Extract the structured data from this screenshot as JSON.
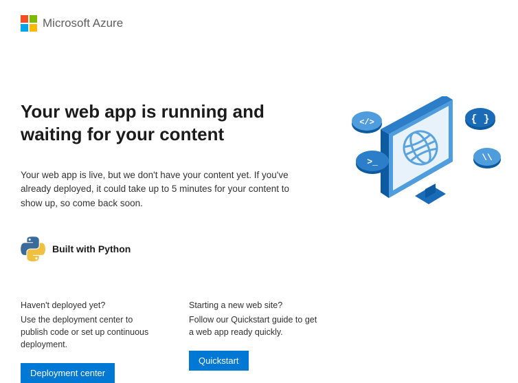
{
  "header": {
    "brand": "Microsoft Azure"
  },
  "main": {
    "title": "Your web app is running and waiting for your content",
    "description": "Your web app is live, but we don't have your content yet. If you've already deployed, it could take up to 5 minutes for your content to show up, so come back soon."
  },
  "built_with": {
    "label": "Built with Python"
  },
  "columns": {
    "deploy": {
      "heading": "Haven't deployed yet?",
      "text": "Use the deployment center to publish code or set up continuous deployment.",
      "button": "Deployment center"
    },
    "quickstart": {
      "heading": "Starting a new web site?",
      "text": "Follow our Quickstart guide to get a web app ready quickly.",
      "button": "Quickstart"
    }
  }
}
